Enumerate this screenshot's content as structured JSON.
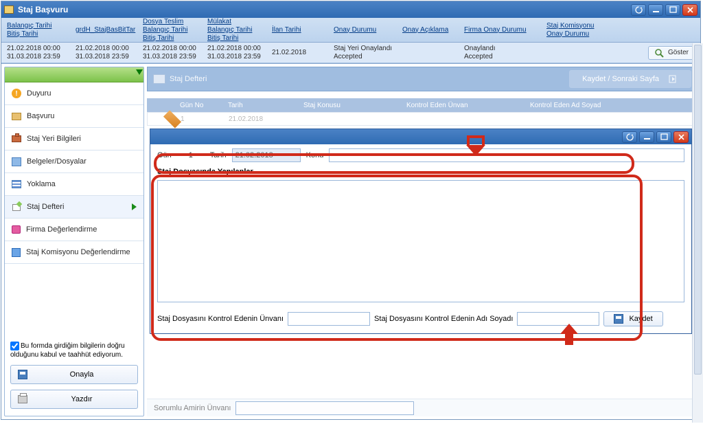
{
  "window": {
    "title": "Staj Başvuru"
  },
  "columns": {
    "c1a": "Balangıç Tarihi",
    "c1b": "Bitiş Tarihi",
    "c2": "grdH_StajBasBitTar",
    "c3a": "Dosya Teslim",
    "c3b": "Balangıç Tarihi",
    "c3c": "Bitiş Tarihi",
    "c4a": "Mülakat",
    "c4b": "Balangıç Tarihi",
    "c4c": "Bitiş Tarihi",
    "c5": "İlan Tarihi",
    "c6": "Onay Durumu",
    "c7": "Onay Açıklama",
    "c8": "Firma Onay Durumu",
    "c9a": "Staj Komisyonu",
    "c9b": "Onay Durumu"
  },
  "row": {
    "d1a": "21.02.2018 00:00",
    "d1b": "31.03.2018 23:59",
    "d2a": "21.02.2018 00:00",
    "d2b": "31.03.2018 23:59",
    "d3a": "21.02.2018 00:00",
    "d3b": "31.03.2018 23:59",
    "d4a": "21.02.2018 00:00",
    "d4b": "31.03.2018 23:59",
    "d5": "21.02.2018",
    "d6a": "Staj Yeri Onaylandı",
    "d6b": "Accepted",
    "d8a": "Onaylandı",
    "d8b": "Accepted",
    "show": "Göster"
  },
  "menu": {
    "m1": "Duyuru",
    "m2": "Başvuru",
    "m3": "Staj Yeri Bilgileri",
    "m4": "Belgeler/Dosyalar",
    "m5": "Yoklama",
    "m6": "Staj Defteri",
    "m7": "Firma Değerlendirme",
    "m8": "Staj Komisyonu Değerlendirme"
  },
  "declare": "Bu formda girdiğim bilgilerin doğru olduğunu kabul ve taahhüt ediyorum.",
  "onayla": "Onayla",
  "yazdir": "Yazdır",
  "defteri": {
    "title": "Staj Defteri",
    "save_next": "Kaydet / Sonraki Sayfa",
    "grid": {
      "gun_no": "Gün No",
      "tarih": "Tarih",
      "konu": "Staj Konusu",
      "unvan": "Kontrol Eden Ünvan",
      "adsoyad": "Kontrol Eden Ad Soyad",
      "r_no": "1",
      "r_tarih": "21.02.2018"
    }
  },
  "form": {
    "gun": "Gün",
    "gun_val": "1",
    "tarih": "Tarih",
    "tarih_val": "21.02.2018",
    "konu": "Konu",
    "section": "Staj Dosyasında Yapılanlar",
    "unvan_lbl": "Staj Dosyasını Kontrol Edenin Ünvanı",
    "ad_lbl": "Staj Dosyasını Kontrol Edenin Adı Soyadı",
    "kaydet": "Kaydet"
  },
  "lower": {
    "label": "Sorumlu Amirin Ünvanı"
  }
}
